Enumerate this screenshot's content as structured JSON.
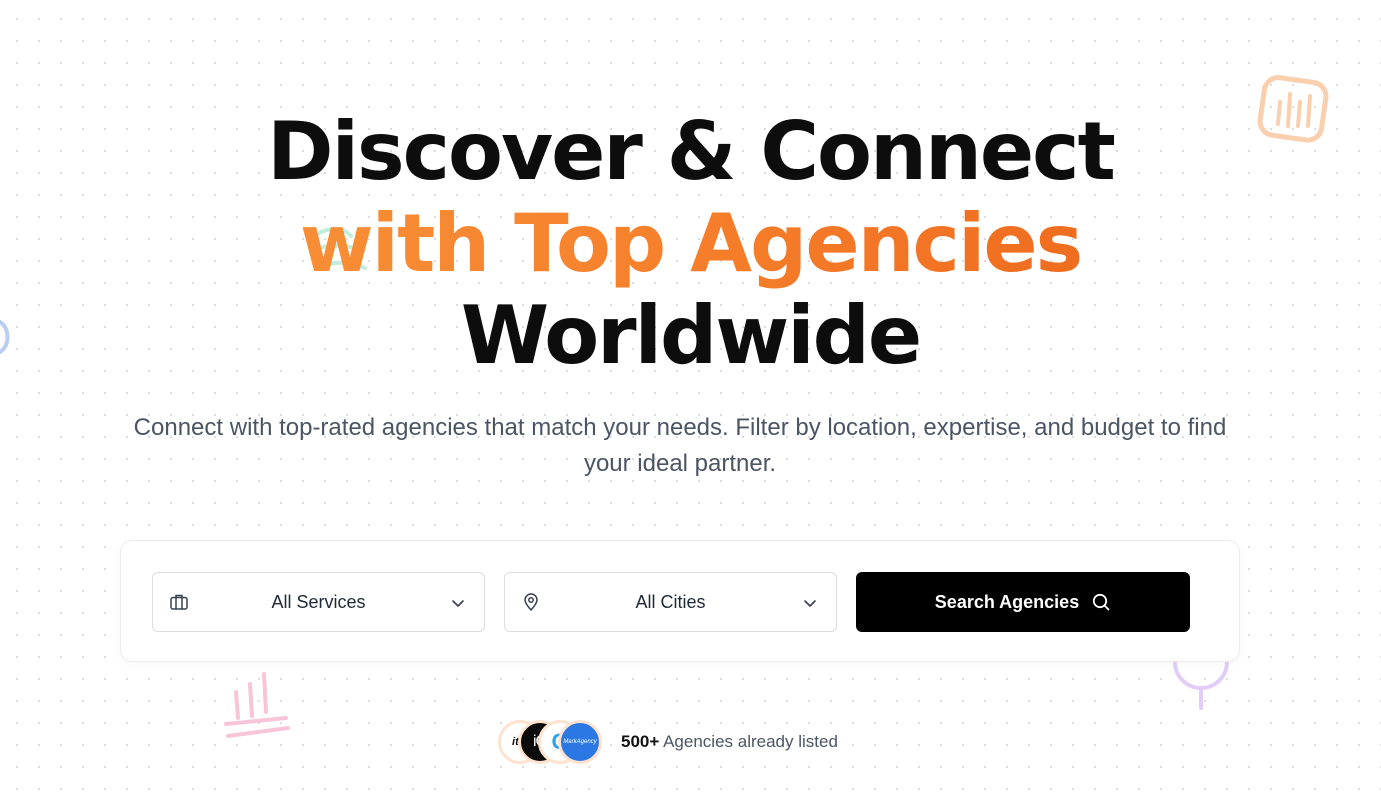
{
  "hero": {
    "line1": "Discover & Connect",
    "line2": "with Top Agencies",
    "line3": "Worldwide",
    "subtitle": "Connect with top-rated agencies that match your needs. Filter by location, expertise, and budget to find your ideal partner."
  },
  "search": {
    "services": {
      "icon": "briefcase-icon",
      "value": "All Services"
    },
    "cities": {
      "icon": "map-pin-icon",
      "value": "All Cities"
    },
    "button_label": "Search Agencies",
    "button_icon": "search-icon"
  },
  "social_proof": {
    "count": "500+",
    "text": "Agencies already listed",
    "avatars": [
      "ital",
      "iO",
      "G",
      "MarkAgency"
    ]
  },
  "colors": {
    "accent_start": "#f79a3e",
    "accent_end": "#ea5f16",
    "button_bg": "#000000",
    "text_muted": "#4b5563"
  }
}
